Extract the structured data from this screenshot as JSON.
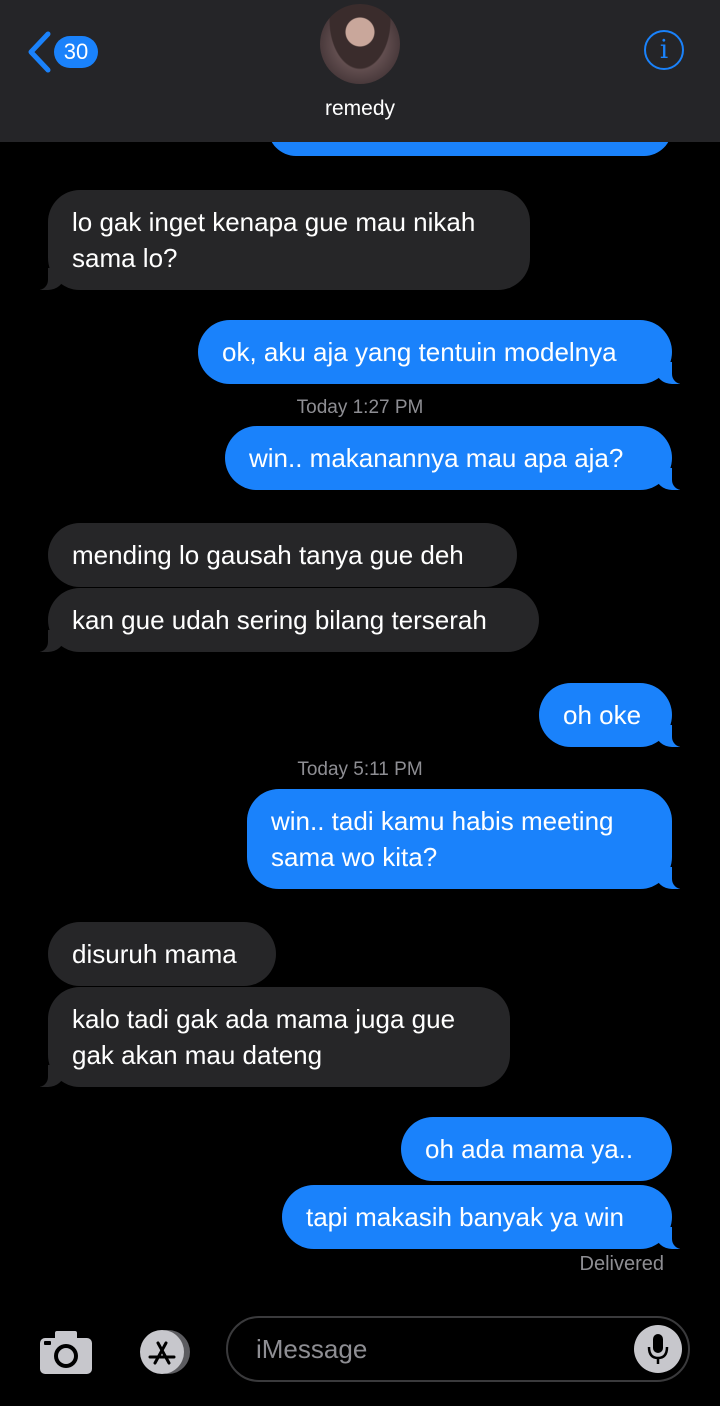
{
  "header": {
    "back_count": "30",
    "contact_name": "remedy",
    "info_label": "i",
    "accent_color": "#1a82fb"
  },
  "messages": [
    {
      "type": "received",
      "text": "lo gak inget kenapa gue mau nikah\nsama lo?"
    },
    {
      "type": "sent",
      "text": "ok, aku aja yang tentuin modelnya"
    },
    {
      "type": "timestamp",
      "text": "Today 1:27 PM"
    },
    {
      "type": "sent",
      "text": "win.. makanannya mau apa aja?"
    },
    {
      "type": "received",
      "text": "mending lo gausah tanya gue deh"
    },
    {
      "type": "received",
      "text": "kan gue udah sering bilang terserah"
    },
    {
      "type": "sent",
      "text": "oh oke"
    },
    {
      "type": "timestamp",
      "text": "Today 5:11 PM"
    },
    {
      "type": "sent",
      "text": "win.. tadi kamu habis meeting\nsama wo kita?"
    },
    {
      "type": "received",
      "text": "disuruh mama"
    },
    {
      "type": "received",
      "text": "kalo tadi gak ada mama juga gue\ngak akan mau dateng"
    },
    {
      "type": "sent",
      "text": "oh ada mama ya.."
    },
    {
      "type": "sent",
      "text": "tapi makasih banyak ya win"
    }
  ],
  "status": "Delivered",
  "composer": {
    "placeholder": "iMessage",
    "camera_icon": "camera-icon",
    "apps_icon": "app-store-icon",
    "mic_icon": "microphone-icon"
  },
  "colors": {
    "sent_bubble": "#1a82fb",
    "received_bubble": "#262628",
    "background": "#000000",
    "header_background": "#252528"
  }
}
